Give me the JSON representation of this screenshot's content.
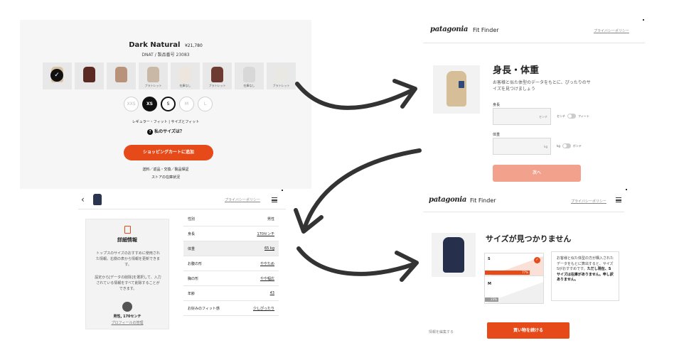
{
  "product": {
    "name": "Dark Natural",
    "price": "¥21,780",
    "code": "DNAT / 製品番号 23083",
    "swatch_captions": [
      "",
      "",
      "",
      "ブラトレット",
      "在庫なし",
      "ブラトレット",
      "在庫なし",
      "ブラトレット"
    ],
    "selected_check": "✓",
    "sizes": [
      "XXS",
      "XS",
      "S",
      "M",
      "L"
    ],
    "fit_line": "レギュラー・フィット | サイズとフィット",
    "my_size_icon": "?",
    "my_size": "私のサイズは？",
    "add_to_cart": "ショッピングカートに追加",
    "shipping": "送料／返品・交換／製品保証",
    "store_stock": "ストアの在庫状況",
    "colors": {
      "accent": "#e64a19"
    }
  },
  "fit_finder_1": {
    "logo": "patagonia",
    "title": "Fit Finder",
    "privacy": "プライバシーポリシー",
    "heading": "身長・体重",
    "description": "お客様と似た体型のデータをもとに、ぴったりのサイズを見つけましょう",
    "height_label": "身長",
    "height_unit": "センチ",
    "height_toggle_a": "センチ",
    "height_toggle_b": "フィート",
    "weight_label": "体重",
    "weight_unit": "kg",
    "weight_toggle_a": "kg",
    "weight_toggle_b": "ポンド",
    "next_button": "次へ"
  },
  "profile": {
    "back": "‹",
    "privacy": "プライバシーポリシー",
    "card_title": "詳細情報",
    "card_desc_1": "トップスのサイズのおすすめに使用された情報。右側の表から情報を更新できます。",
    "card_desc_2": "設定から[データの削除]を選択して、入力されている情報をすべて削除することができます。",
    "profile_info": "男性, 170センチ",
    "profile_link": "プロフィールの管理",
    "rows": [
      {
        "label": "性別",
        "value": "男性",
        "link": false
      },
      {
        "label": "身長",
        "value": "170センチ",
        "link": true
      },
      {
        "label": "体重",
        "value": "65 kg",
        "link": true
      },
      {
        "label": "お腹の形",
        "value": "ややため",
        "link": true
      },
      {
        "label": "胸の形",
        "value": "やや幅広",
        "link": true
      },
      {
        "label": "年齢",
        "value": "43",
        "link": true
      },
      {
        "label": "お好みのフィット感",
        "value": "少しぴったり",
        "link": true
      }
    ]
  },
  "fit_finder_2": {
    "logo": "patagonia",
    "title": "Fit Finder",
    "privacy": "プライバシーポリシー",
    "heading": "サイズが見つかりません",
    "size_s": "S",
    "size_s_pct": "77%",
    "size_s_value": 0.77,
    "size_m": "M",
    "size_m_pct": "23%",
    "size_m_value": 0.23,
    "check": "✓",
    "note_plain": "お客様と似た体型の方が購入されたデータをもとに算出すると、サイズSがおすすめです。",
    "note_bold": "ただし現在、Sサイズは在庫がありません。申し訳ありません。",
    "edit_info": "情報を編集する",
    "continue_button": "買い物を続ける"
  }
}
